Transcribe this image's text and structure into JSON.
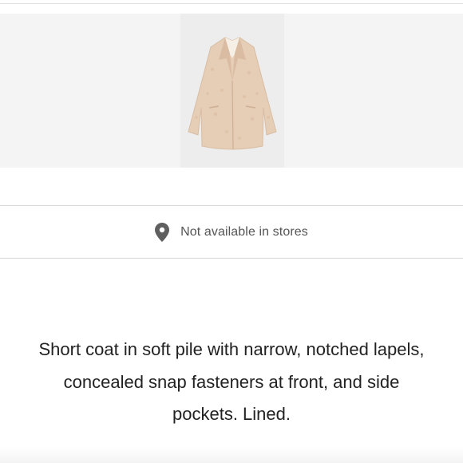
{
  "product": {
    "image_icon": "teddy-coat-image"
  },
  "availability": {
    "icon": "location-pin-icon",
    "text": "Not available in stores"
  },
  "description": {
    "text": "Short coat in soft pile with narrow, notched lapels, concealed snap fasteners at front, and side pockets. Lined."
  }
}
